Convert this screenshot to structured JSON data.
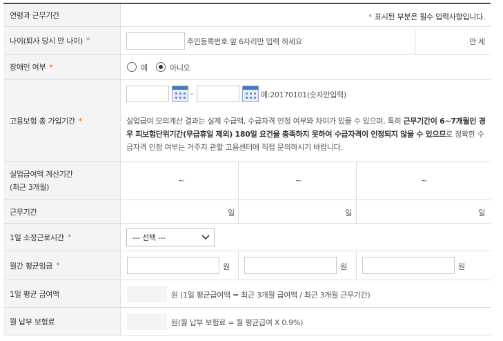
{
  "header": {
    "title": "연령과 근무기간",
    "required_mark": "*",
    "required_note": "표시된 부분은 필수 입력사항입니다."
  },
  "age": {
    "label": "나이(퇴사 당시 만 나이)",
    "required_mark": "*",
    "value": "",
    "hint": "주민등록번호 앞 6자리만 입력 하세요",
    "unit": "만 세"
  },
  "disability": {
    "label": "장애인 여부",
    "required_mark": "*",
    "options": [
      {
        "label": "예",
        "checked": false
      },
      {
        "label": "아니오",
        "checked": true
      }
    ]
  },
  "insurance": {
    "label": "고용보험 총 가입기간",
    "required_mark": "*",
    "start_value": "",
    "end_value": "",
    "separator": "-",
    "example": "예:20170101(숫자만입력)",
    "notice_1": "실업급여 모의계산 결과는 실제 수급액, 수급자격 인정 여부와 차이가 있을 수 있으며, 특히 ",
    "notice_bold": "근무기간이 6~7개월인 경우 피보험단위기간(무급휴일 제외) 180일 요건을 충족하지 못하여 수급자격이 인정되지 않을 수 있으므",
    "notice_2": "로 정확한 수급자격 인정 여부는 거주지 관할 고용센터에 직접 문의하시기 바랍니다."
  },
  "calc_period": {
    "label_line1": "실업급여액 계산기간",
    "label_line2": "(최근 3개월)",
    "tilde": [
      "~",
      "~",
      "~"
    ]
  },
  "work_period": {
    "label": "근무기간",
    "unit": [
      "일",
      "일",
      "일"
    ]
  },
  "daily_hours": {
    "label": "1일 소정근로시간",
    "required_mark": "*",
    "selected": "--- 선택 ---"
  },
  "monthly_wage": {
    "label": "월간 평균임금",
    "required_mark": "*",
    "unit": [
      "원",
      "원",
      "원"
    ]
  },
  "daily_benefit": {
    "label": "1일 평균 급여액",
    "text": "원 (1일 평균급여액 = 최근 3개월 급여액 / 최근 3개월 근무기간)"
  },
  "monthly_premium": {
    "label": "월 납부 보험료",
    "text": "원(월 납부 보험료 = 월 평균급여 X 0.9%)"
  }
}
